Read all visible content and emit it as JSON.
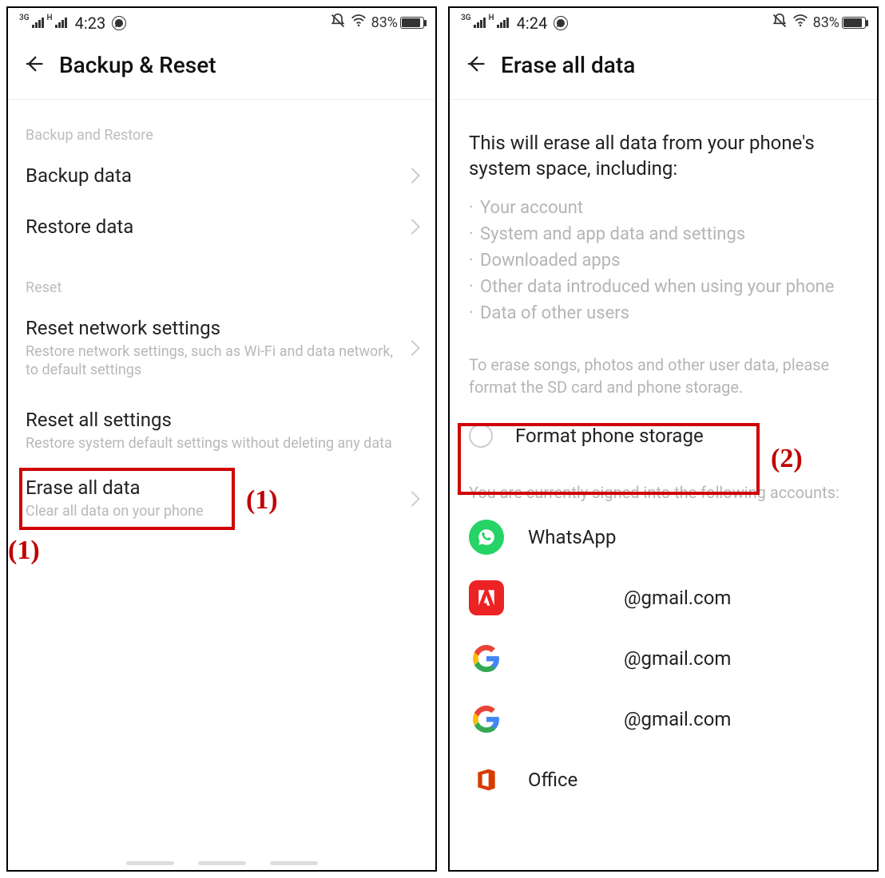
{
  "left": {
    "status": {
      "net1": "3G",
      "net2": "H",
      "time": "4:23",
      "battery": "83%"
    },
    "header": {
      "title": "Backup & Reset"
    },
    "sectionBackup": "Backup and Restore",
    "backupData": {
      "title": "Backup data"
    },
    "restoreData": {
      "title": "Restore data"
    },
    "sectionReset": "Reset",
    "resetNetwork": {
      "title": "Reset network settings",
      "sub": "Restore network settings, such as Wi-Fi and data network, to default settings"
    },
    "resetAll": {
      "title": "Reset all settings",
      "sub": "Restore system default settings without deleting any data"
    },
    "eraseAll": {
      "title": "Erase all data",
      "sub": "Clear all data on your phone"
    },
    "annot": "(1)"
  },
  "right": {
    "status": {
      "net1": "3G",
      "net2": "H",
      "time": "4:24",
      "battery": "83%"
    },
    "header": {
      "title": "Erase all data"
    },
    "bodyText": "This will erase all data from your phone's system space, including:",
    "bullets": [
      "Your account",
      "System and app data and settings",
      "Downloaded apps",
      "Other data introduced when using your phone",
      "Data of other users"
    ],
    "hint": "To erase songs, photos and other user data, please format the SD card and phone storage.",
    "format": {
      "label": "Format phone storage"
    },
    "signedLabel": "You are currently signed into the following accounts:",
    "accounts": [
      {
        "name": "WhatsApp"
      },
      {
        "name": "@gmail.com"
      },
      {
        "name": "@gmail.com"
      },
      {
        "name": "@gmail.com"
      },
      {
        "name": "Office"
      }
    ],
    "annot": "(2)"
  }
}
